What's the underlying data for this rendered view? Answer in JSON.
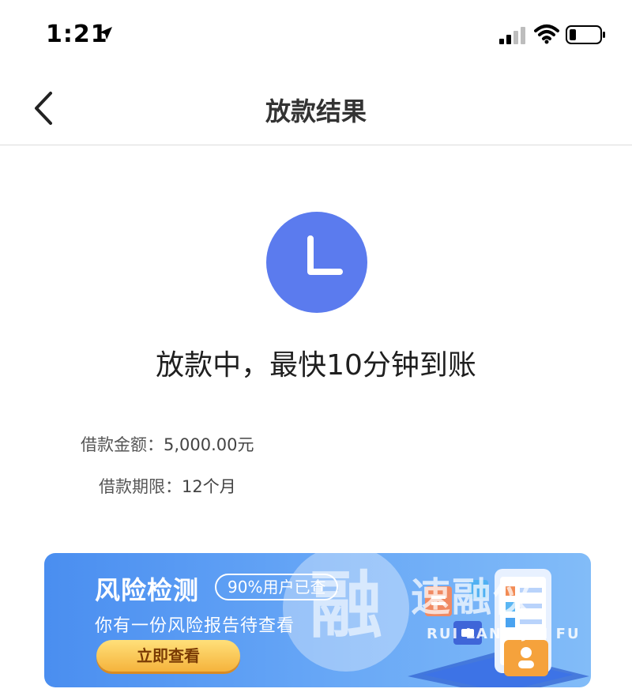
{
  "status_bar": {
    "time": "1:21"
  },
  "nav": {
    "title": "放款结果"
  },
  "status": {
    "icon": "clock-icon",
    "color": "#5b7bee",
    "message": "放款中，最快10分钟到账"
  },
  "loan": {
    "amount_label": "借款金额：",
    "amount_value": "5,000.00元",
    "term_label": "借款期限：",
    "term_value": "12个月"
  },
  "banner": {
    "title": "风险检测",
    "badge": "90%用户已查",
    "subtitle": "你有一份风险报告待查看",
    "button": "立即查看"
  },
  "watermark": {
    "glyph": "融",
    "text": "速融侠",
    "pinyin": "RUI LANG JIN FU"
  }
}
